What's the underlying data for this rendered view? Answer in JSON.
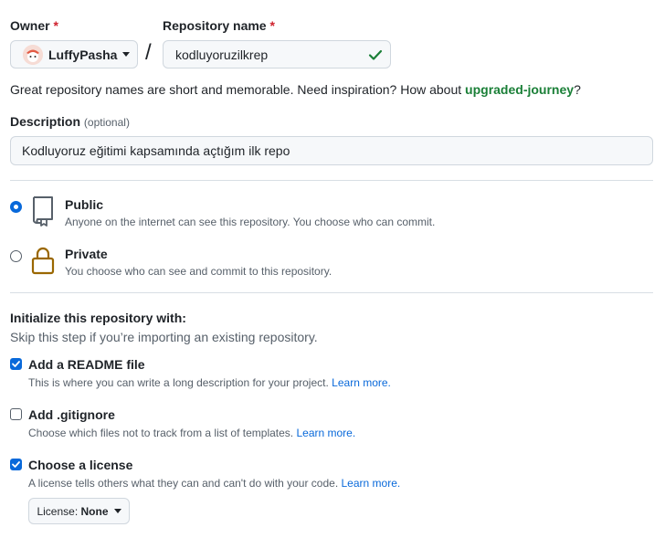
{
  "owner": {
    "label": "Owner",
    "required_mark": "*",
    "value": "LuffyPasha"
  },
  "separator": "/",
  "repo": {
    "label": "Repository name",
    "required_mark": "*",
    "value": "kodluyoruzilkrep",
    "valid": true
  },
  "hint": {
    "text": "Great repository names are short and memorable. Need inspiration? How about ",
    "suggestion": "upgraded-journey",
    "end": "?"
  },
  "description": {
    "label": "Description",
    "optional": "(optional)",
    "value": "Kodluyoruz eğitimi kapsamında açtığım ilk repo"
  },
  "visibility": {
    "public": {
      "title": "Public",
      "desc": "Anyone on the internet can see this repository. You choose who can commit.",
      "selected": true
    },
    "private": {
      "title": "Private",
      "desc": "You choose who can see and commit to this repository.",
      "selected": false
    }
  },
  "init": {
    "heading": "Initialize this repository with:",
    "subtext": "Skip this step if you’re importing an existing repository.",
    "readme": {
      "title": "Add a README file",
      "desc": "This is where you can write a long description for your project.",
      "link": "Learn more.",
      "checked": true
    },
    "gitignore": {
      "title": "Add .gitignore",
      "desc": "Choose which files not to track from a list of templates.",
      "link": "Learn more.",
      "checked": false
    },
    "license": {
      "title": "Choose a license",
      "desc": "A license tells others what they can and can't do with your code.",
      "link": "Learn more.",
      "checked": true,
      "select_label": "License:",
      "select_value": "None"
    }
  },
  "colors": {
    "accent": "#0969da",
    "success": "#1a7f37",
    "danger": "#cf222e",
    "private_icon": "#9a6700"
  }
}
